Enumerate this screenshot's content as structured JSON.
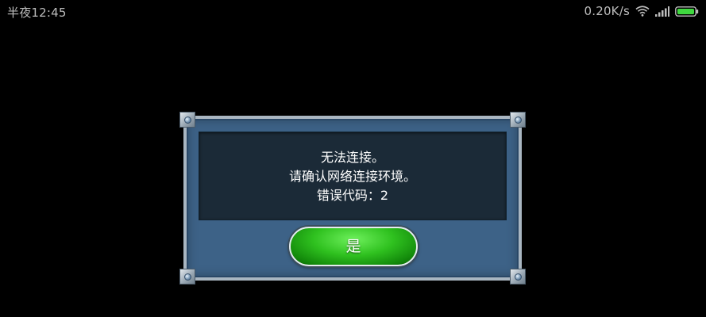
{
  "status_bar": {
    "time": "半夜12:45",
    "net_speed": "0.20K/s",
    "wifi_icon": "wifi-icon",
    "signal_icon": "signal-icon",
    "battery_icon": "battery-icon"
  },
  "dialog": {
    "message_lines": [
      "无法连接。",
      "请确认网络连接环境。",
      "错误代码：2"
    ],
    "confirm_label": "是"
  },
  "colors": {
    "dialog_bg": "#3d6287",
    "panel_bg": "#1b2a37",
    "button_green": "#2fc11f"
  }
}
